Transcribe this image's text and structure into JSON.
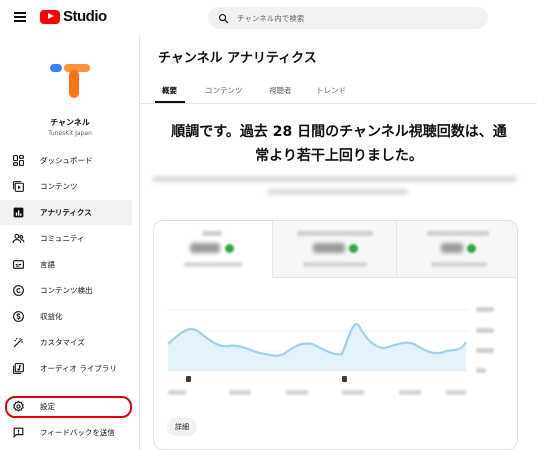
{
  "header": {
    "menu_icon": "hamburger-icon",
    "logo_text": "Studio",
    "logo_color": "#ff0000",
    "search_placeholder": "チャンネル内で検索"
  },
  "channel": {
    "name": "チャンネル",
    "subtitle": "TunesKit Japan"
  },
  "sidebar": {
    "items": [
      {
        "label": "ダッシュボード",
        "icon": "dashboard-icon"
      },
      {
        "label": "コンテンツ",
        "icon": "content-icon"
      },
      {
        "label": "アナリティクス",
        "icon": "analytics-icon",
        "active": true
      },
      {
        "label": "コミュニティ",
        "icon": "community-icon"
      },
      {
        "label": "言語",
        "icon": "subtitles-icon"
      },
      {
        "label": "コンテンツ検出",
        "icon": "copyright-icon"
      },
      {
        "label": "収益化",
        "icon": "dollar-icon"
      },
      {
        "label": "カスタマイズ",
        "icon": "magic-wand-icon"
      },
      {
        "label": "オーディオ ライブラリ",
        "icon": "audio-library-icon"
      },
      {
        "label": "設定",
        "icon": "gear-icon",
        "highlighted": true
      },
      {
        "label": "フィードバックを送信",
        "icon": "feedback-icon"
      }
    ]
  },
  "main": {
    "title": "チャンネル アナリティクス",
    "tabs": [
      {
        "label": "概要",
        "active": true
      },
      {
        "label": "コンテンツ"
      },
      {
        "label": "視聴者"
      },
      {
        "label": "トレンド"
      }
    ],
    "headline_line1": "順調です。過去 28 日間のチャンネル視聴回数は、通",
    "headline_line2": "常より若干上回りました。",
    "detail_button": "詳細"
  },
  "colors": {
    "accent": "#0f0f0f",
    "highlight_ring": "#e00000",
    "chart_line": "#9fd1ee",
    "chart_fill": "#e3f2fb",
    "positive": "#2ba640"
  }
}
